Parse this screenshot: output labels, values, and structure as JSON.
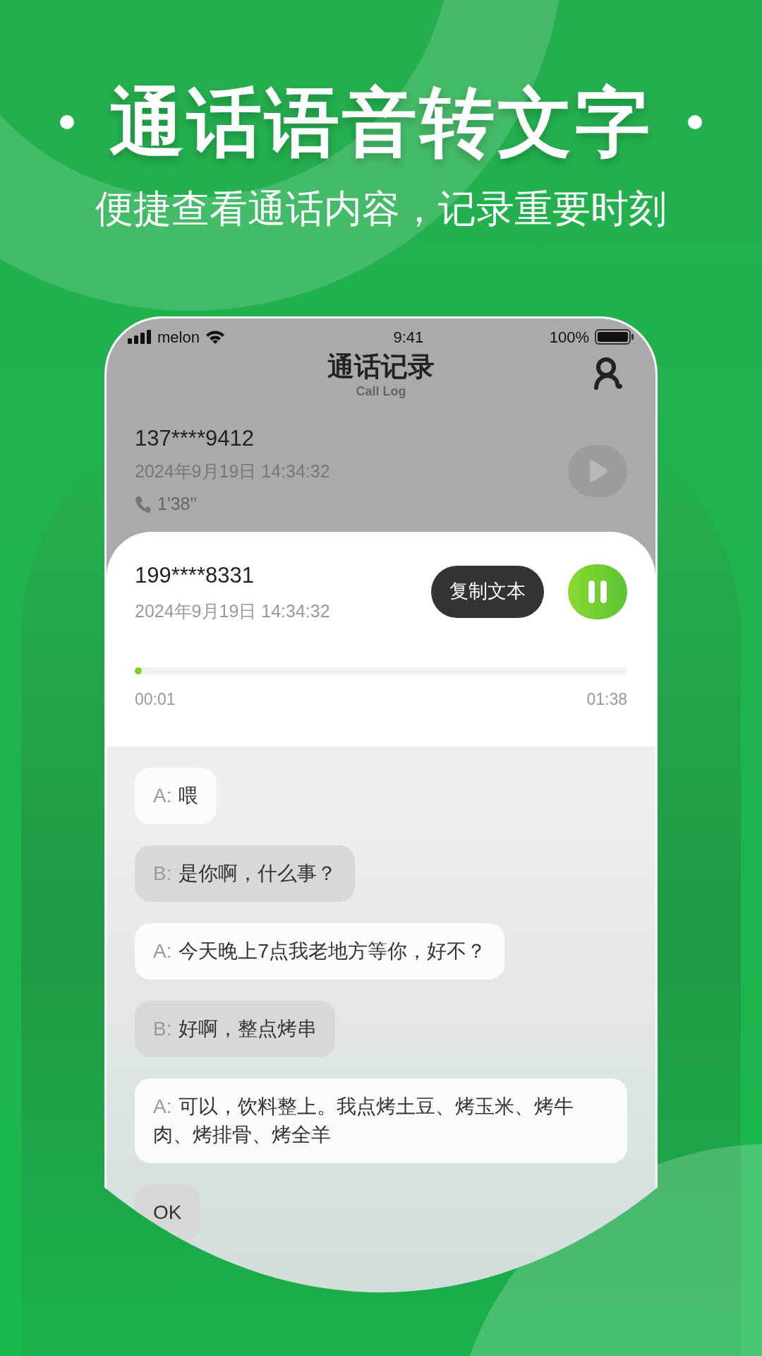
{
  "headline": "通话语音转文字",
  "subtitle": "便捷查看通话内容，记录重要时刻",
  "status_bar": {
    "carrier": "melon",
    "time": "9:41",
    "battery": "100%"
  },
  "header": {
    "title": "通话记录",
    "subtitle": "Call Log"
  },
  "calls": [
    {
      "number": "137****9412",
      "date": "2024年9月19日 14:34:32",
      "duration": "1'38''",
      "expanded": false,
      "playing": false
    },
    {
      "number": "199****8331",
      "date": "2024年9月19日 14:34:32",
      "expanded": true,
      "playing": true,
      "copy_button": "复制文本",
      "level": 0.01,
      "elapsed": "00:01",
      "total": "01:38"
    }
  ],
  "transcript": [
    {
      "kind": "A",
      "speaker": "A:",
      "text": "喂"
    },
    {
      "kind": "B",
      "speaker": "B:",
      "text": "是你啊，什么事？"
    },
    {
      "kind": "A",
      "speaker": "A:",
      "text": "今天晚上7点我老地方等你，好不？"
    },
    {
      "kind": "B",
      "speaker": "B:",
      "text": "好啊，整点烤串"
    },
    {
      "kind": "A",
      "speaker": "A:",
      "text": "可以，饮料整上。我点烤土豆、烤玉米、烤牛肉、烤排骨、烤全羊"
    },
    {
      "kind": "B",
      "text": "OK"
    }
  ]
}
